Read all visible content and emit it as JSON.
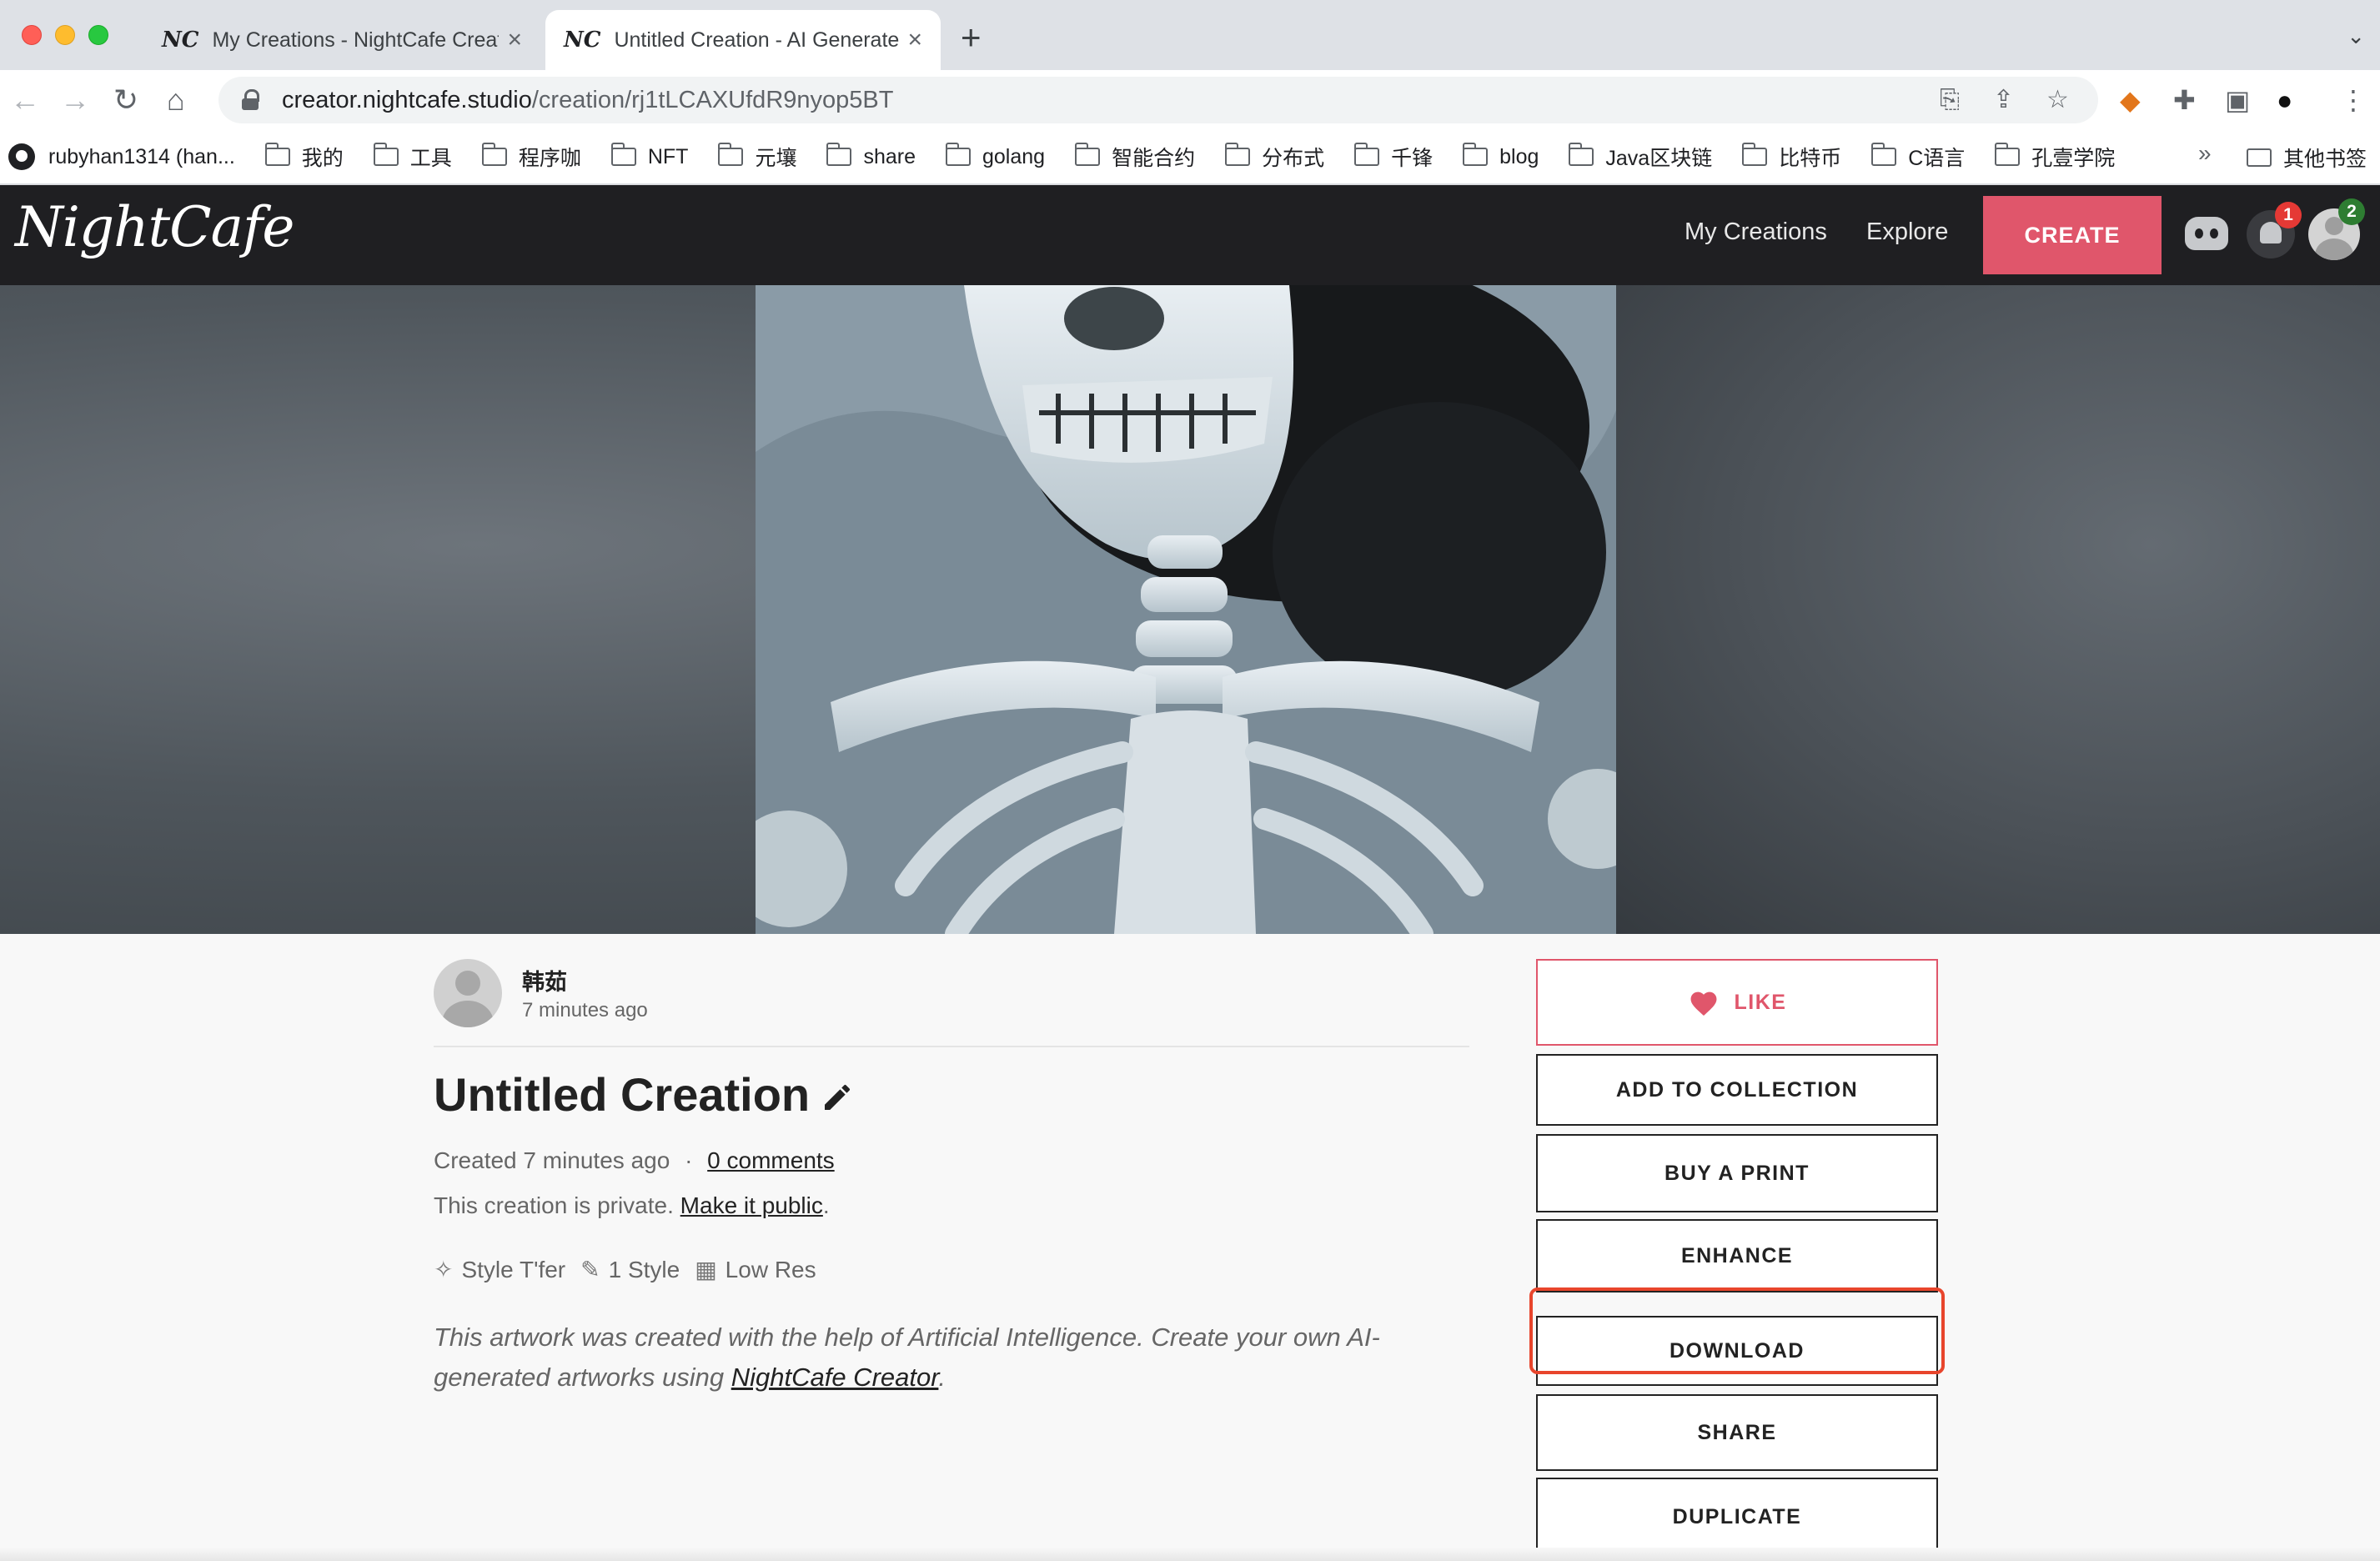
{
  "browser": {
    "tabs": [
      {
        "title": "My Creations - NightCafe Creator",
        "favicon": "NC",
        "active": false
      },
      {
        "title": "Untitled Creation - AI Generated",
        "favicon": "NC",
        "active": true
      }
    ],
    "url_host": "creator.nightcafe.studio",
    "url_path": "/creation/rj1tLCAXUfdR9nyop5BT",
    "bookmarks": [
      {
        "label": "rubyhan1314 (han...",
        "icon": "github-icon"
      },
      {
        "label": "我的",
        "icon": "folder-icon"
      },
      {
        "label": "工具",
        "icon": "folder-icon"
      },
      {
        "label": "程序咖",
        "icon": "folder-icon"
      },
      {
        "label": "NFT",
        "icon": "folder-icon"
      },
      {
        "label": "元壤",
        "icon": "folder-icon"
      },
      {
        "label": "share",
        "icon": "folder-icon"
      },
      {
        "label": "golang",
        "icon": "folder-icon"
      },
      {
        "label": "智能合约",
        "icon": "folder-icon"
      },
      {
        "label": "分布式",
        "icon": "folder-icon"
      },
      {
        "label": "千锋",
        "icon": "folder-icon"
      },
      {
        "label": "blog",
        "icon": "folder-icon"
      },
      {
        "label": "Java区块链",
        "icon": "folder-icon"
      },
      {
        "label": "比特币",
        "icon": "folder-icon"
      },
      {
        "label": "C语言",
        "icon": "folder-icon"
      },
      {
        "label": "孔壹学院",
        "icon": "folder-icon"
      }
    ],
    "bookmarks_more": "»",
    "other_bookmarks": "其他书签"
  },
  "site": {
    "logo": "NightCafe",
    "nav": {
      "my_creations": "My Creations",
      "explore": "Explore",
      "create": "CREATE"
    },
    "notifications_count": "1",
    "profile_badge": "2",
    "accent_color": "#e0566b"
  },
  "creation": {
    "username": "韩茹",
    "posted_ago": "7 minutes ago",
    "title": "Untitled Creation",
    "created_prefix": "Created 7 minutes ago",
    "separator": "·",
    "comments_link": "0 comments",
    "private_text": "This creation is private.",
    "make_public_link": "Make it public",
    "tags": [
      {
        "icon": "magic-wand-icon",
        "label": "Style T'fer"
      },
      {
        "icon": "brush-icon",
        "label": "1 Style"
      },
      {
        "icon": "image-res-icon",
        "label": "Low Res"
      }
    ],
    "note_text": "This artwork was created with the help of Artificial Intelligence. Create your own AI-generated artworks using",
    "note_link": "NightCafe Creator",
    "note_end": "."
  },
  "actions": {
    "like": "LIKE",
    "add_to_collection": "ADD TO COLLECTION",
    "buy_a_print": "BUY A PRINT",
    "enhance": "ENHANCE",
    "download": "DOWNLOAD",
    "share": "SHARE",
    "duplicate": "DUPLICATE"
  }
}
